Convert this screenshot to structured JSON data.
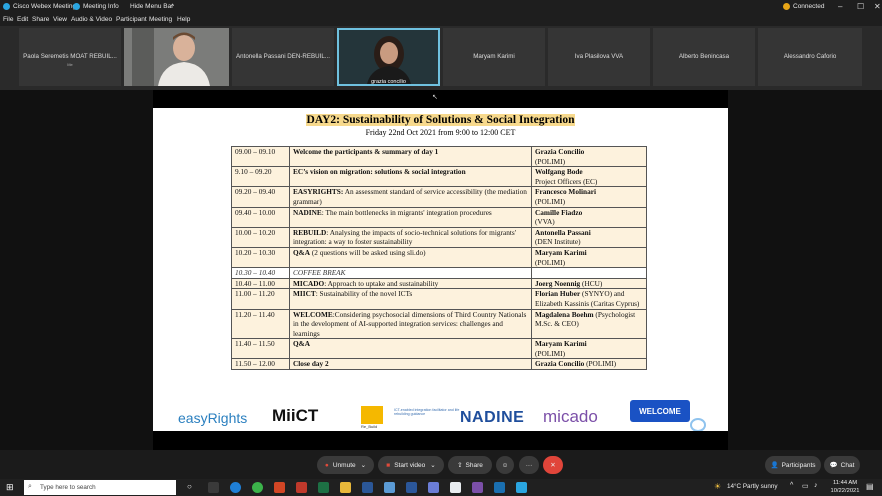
{
  "titlebar": {
    "app": "Cisco Webex Meetings",
    "meeting_info": "Meeting Info",
    "hide_menu": "Hide Menu Bar",
    "connected": "Connected"
  },
  "menu": [
    "File",
    "Edit",
    "Share",
    "View",
    "Audio & Video",
    "Participant",
    "Meeting",
    "Help"
  ],
  "participants": [
    {
      "name": "Paola Seremetis MOAT REBUIL...",
      "sub": "Me"
    },
    {
      "name": "",
      "sub": ""
    },
    {
      "name": "Antonella Passani DEN-REBUIL...",
      "sub": ""
    },
    {
      "name": "grazia concilio",
      "sub": ""
    },
    {
      "name": "Maryam Karimi",
      "sub": ""
    },
    {
      "name": "Iva Plasilova VVA",
      "sub": ""
    },
    {
      "name": "Alberto Benincasa",
      "sub": ""
    },
    {
      "name": "Alessandro Caforio",
      "sub": ""
    }
  ],
  "slide": {
    "title": "DAY2: Sustainability of Solutions & Social Integration",
    "subtitle": "Friday 22nd Oct 2021 from 9:00 to 12:00 CET",
    "rows": [
      {
        "time": "09.00 – 09.10",
        "topic_b": "Welcome the participants & summary of day 1",
        "topic": "",
        "speaker_b": "Grazia Concilio",
        "speaker": "(POLIMI)"
      },
      {
        "time": "9.10 – 09.20",
        "topic_b": "EC’s vision on migration: solutions & social integration",
        "topic": "",
        "speaker_b": "Wolfgang Bode",
        "speaker": "Project Officers (EC)"
      },
      {
        "time": "09.20 – 09.40",
        "topic_b": "EASYRIGHTS:",
        "topic": " An assessment standard of service accessibility (the mediation grammar)",
        "speaker_b": "Francesco Molinari",
        "speaker": "(POLIMI)"
      },
      {
        "time": "09.40 – 10.00",
        "topic_b": "NADINE",
        "topic": ": The main bottlenecks in migrants' integration procedures",
        "speaker_b": "Camille Fiadzo",
        "speaker": "(VVA)"
      },
      {
        "time": "10.00 – 10.20",
        "topic_b": "REBUILD",
        "topic": ": Analysing the impacts of socio-technical solutions for migrants' integration: a way to foster sustainability",
        "speaker_b": "Antonella Passani",
        "speaker": "(DEN Institute)"
      },
      {
        "time": "10.20 – 10.30",
        "topic_b": "Q&A",
        "topic": " (2 questions will be asked using sli.do)",
        "speaker_b": "Maryam Karimi",
        "speaker": "(POLIMI)"
      },
      {
        "time": "10.30 – 10.40",
        "topic_b": "",
        "topic": "COFFEE BREAK",
        "speaker_b": "",
        "speaker": "",
        "brk": true
      },
      {
        "time": "10.40 – 11.00",
        "topic_b": "MICADO",
        "topic": ": Approach to uptake and sustainability",
        "speaker_b": "Joerg Noennig",
        "speaker": " (HCU)"
      },
      {
        "time": "11.00 – 11.20",
        "topic_b": "MIICT",
        "topic": ": Sustainability of the novel ICTs",
        "speaker_b": "Florian Huber",
        "speaker": " (SYNYO) and Elizabeth Kassinis (Caritas Cyprus)"
      },
      {
        "time": "11.20 – 11.40",
        "topic_b": "WELCOME",
        "topic": ":Considering psychosocial dimensions of Third Country Nationals in the development of AI-supported integration services: challenges and learnings",
        "speaker_b": "Magdalena Boehm",
        "speaker": " (Psychologist M.Sc. & CEO)"
      },
      {
        "time": "11.40 – 11.50",
        "topic_b": "Q&A",
        "topic": "",
        "speaker_b": "Maryam Karimi",
        "speaker": "(POLIMI)"
      },
      {
        "time": "11.50 – 12.00",
        "topic_b": "Close day 2",
        "topic": "",
        "speaker_b": "Grazia Concilio",
        "speaker": " (POLIMI)"
      }
    ],
    "logos": [
      "easyRights",
      "MiiCT",
      "Re_Build",
      "ICT-enabled integration facilitator and life rebuilding guidance",
      "NADINE",
      "micado",
      "WELCOME"
    ]
  },
  "controls": {
    "mute": "Unmute",
    "video": "Start video",
    "share": "Share",
    "participants": "Participants",
    "chat": "Chat"
  },
  "taskbar": {
    "search": "Type here to search",
    "weather": "14°C  Partly sunny",
    "time": "11:44 AM",
    "date": "10/22/2021"
  }
}
